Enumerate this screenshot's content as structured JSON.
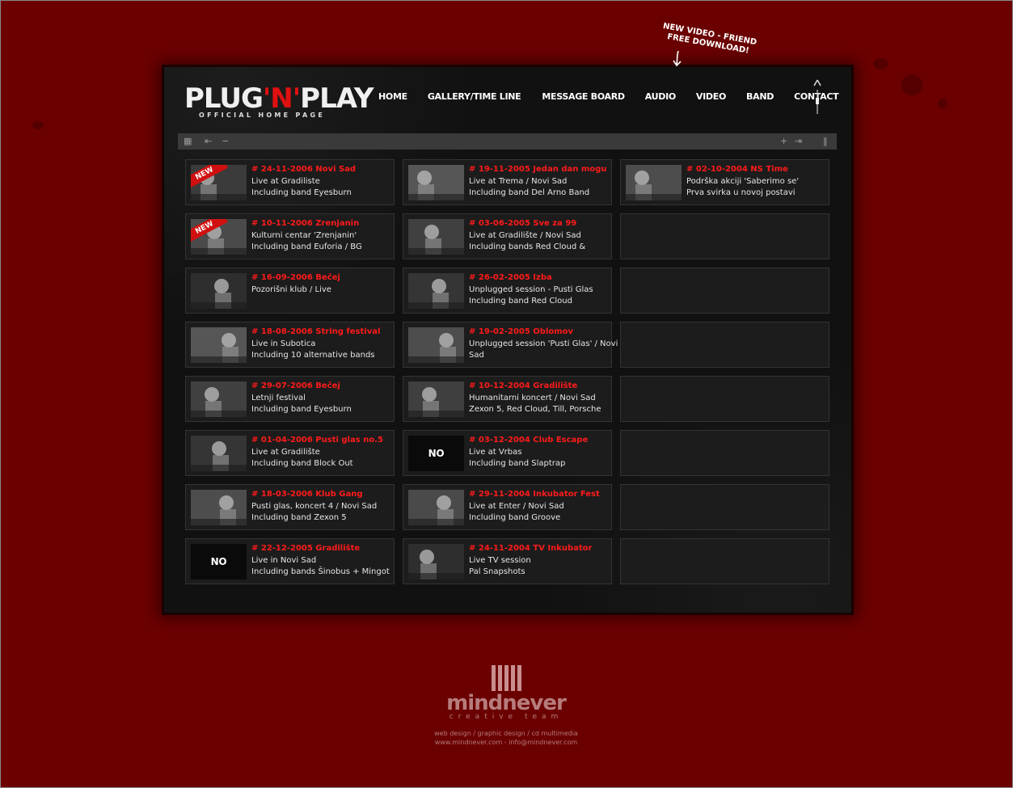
{
  "site": {
    "logo_main_a": "PLUG",
    "logo_main_n": "'N'",
    "logo_main_b": "PLAY",
    "logo_sub": "OFFICIAL HOME PAGE"
  },
  "promo": {
    "line1": "NEW VIDEO - FRIEND",
    "line2": "FREE DOWNLOAD!"
  },
  "nav": {
    "home": "HOME",
    "gallery": "GALLERY/TIME LINE",
    "message_board": "MESSAGE BOARD",
    "audio": "AUDIO",
    "video": "VIDEO",
    "band": "BAND",
    "contact": "CONTACT"
  },
  "toolbar": {
    "grid_icon": "grid-view-icon",
    "first_icon": "first-page-icon",
    "minus_icon": "zoom-out-icon",
    "plus_icon": "zoom-in-icon",
    "last_icon": "last-page-icon",
    "pause_icon": "pause-icon"
  },
  "columns": [
    [
      {
        "title": "# 24-11-2006 Novi Sad",
        "l1": "Live at Gradiliste",
        "l2": "Including band Eyesburn",
        "thumb": "photo",
        "new": true
      },
      {
        "title": "# 10-11-2006 Zrenjanin",
        "l1": "Kulturni centar 'Zrenjanin'",
        "l2": "Including band Euforia / BG",
        "thumb": "photo",
        "new": true
      },
      {
        "title": "# 16-09-2006 Bečej",
        "l1": "Pozorišni klub / Live",
        "l2": "",
        "thumb": "photo",
        "new": false
      },
      {
        "title": "# 18-08-2006 String festival",
        "l1": "Live in Subotica",
        "l2": "Including 10 alternative bands",
        "thumb": "photo",
        "new": false
      },
      {
        "title": "# 29-07-2006 Bečej",
        "l1": "Letnji festival",
        "l2": "Including band Eyesburn",
        "thumb": "photo",
        "new": false
      },
      {
        "title": "# 01-04-2006 Pusti glas no.5",
        "l1": "Live at Gradilište",
        "l2": "Including band Block Out",
        "thumb": "photo",
        "new": false
      },
      {
        "title": "# 18-03-2006 Klub Gang",
        "l1": "Pusti glas, koncert 4 / Novi Sad",
        "l2": "Including band Zexon 5",
        "thumb": "photo",
        "new": false
      },
      {
        "title": "# 22-12-2005 Gradilište",
        "l1": "Live in Novi Sad",
        "l2": "Including bands Šinobus + Mingot",
        "thumb": "noimages",
        "new": false
      }
    ],
    [
      {
        "title": "# 19-11-2005 Jedan dan mogu",
        "l1": "Live at Trema / Novi Sad",
        "l2": "Including band Del Arno Band",
        "thumb": "photo",
        "new": false
      },
      {
        "title": "# 03-06-2005 Sve za 99",
        "l1": "Live at Gradilište / Novi Sad",
        "l2": "Including bands Red Cloud &",
        "thumb": "photo",
        "new": false
      },
      {
        "title": "# 26-02-2005 Izba",
        "l1": "Unplugged session - Pusti Glas",
        "l2": "Including band Red Cloud",
        "thumb": "photo",
        "new": false
      },
      {
        "title": "# 19-02-2005 Oblomov",
        "l1": "Unplugged session 'Pusti Glas' / Novi",
        "l2": "Sad",
        "thumb": "photo",
        "new": false
      },
      {
        "title": "# 10-12-2004 Gradilište",
        "l1": "Humanitarni koncert / Novi Sad",
        "l2": "Zexon 5, Red Cloud, Till, Porsche",
        "thumb": "photo",
        "new": false
      },
      {
        "title": "# 03-12-2004 Club Escape",
        "l1": "Live at Vrbas",
        "l2": "Including band Slaptrap",
        "thumb": "noimages",
        "new": false
      },
      {
        "title": "# 29-11-2004 Inkubator Fest",
        "l1": "Live at Enter / Novi Sad",
        "l2": "Including band Groove",
        "thumb": "photo",
        "new": false
      },
      {
        "title": "# 24-11-2004 TV Inkubator",
        "l1": "Live TV session",
        "l2": "Pal Snapshots",
        "thumb": "photo",
        "new": false
      }
    ],
    [
      {
        "title": "# 02-10-2004 NS Time",
        "l1": "Podrška akciji 'Saberimo se'",
        "l2": "Prva svirka u novoj postavi",
        "thumb": "photo",
        "new": false
      },
      null,
      null,
      null,
      null,
      null,
      null,
      null
    ]
  ],
  "labels": {
    "new_badge": "NEW",
    "no_images": "NO IMAGES"
  },
  "footer": {
    "brand": "mindnever",
    "tagline": "creative team",
    "line1": "web design / graphic design / cd multimedia",
    "line2": "www.mindnever.com - info@mindnever.com"
  }
}
